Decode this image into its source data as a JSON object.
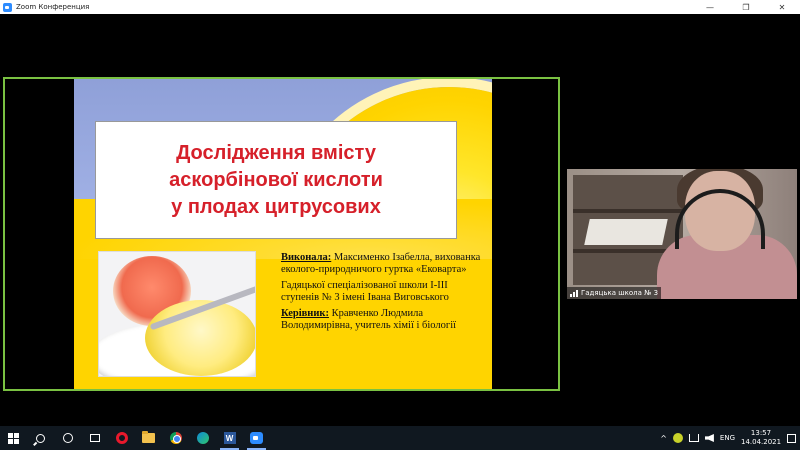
{
  "window": {
    "title": "Zoom Конференция",
    "controls": {
      "minimize": "—",
      "restore": "❐",
      "close": "✕"
    }
  },
  "slide": {
    "title_lines": [
      "Дослідження вмісту",
      "аскорбінової кислоти",
      "у плодах цитрусових"
    ],
    "author_label": "Виконала:",
    "author_text": " Максименко Ізабелла, вихованка еколого-природничого гуртка «Ековарта»",
    "school_text": "Гадяцької спеціалізованої школи І-ІІІ ступенів № 3 імені Івана Виговського",
    "supervisor_label": "Керівник:",
    "supervisor_text": " Кравченко Людмила Володимирівна, учитель хімії і біології",
    "title_color": "#d6202a"
  },
  "participant": {
    "name": "Гадяцька школа № 3"
  },
  "taskbar": {
    "icons": [
      "windows-start-icon",
      "search-icon",
      "cortana-icon",
      "task-view-icon",
      "opera-icon",
      "file-explorer-icon",
      "chrome-icon",
      "edge-icon",
      "word-icon",
      "zoom-icon"
    ],
    "word_letter": "W",
    "tray": {
      "chevron": "^",
      "language": "ENG",
      "time": "13:57",
      "date": "14.04.2021"
    }
  },
  "colors": {
    "active_speaker_border": "#7ac142",
    "taskbar_bg": "#101820",
    "zoom_blue": "#2d8cff"
  }
}
